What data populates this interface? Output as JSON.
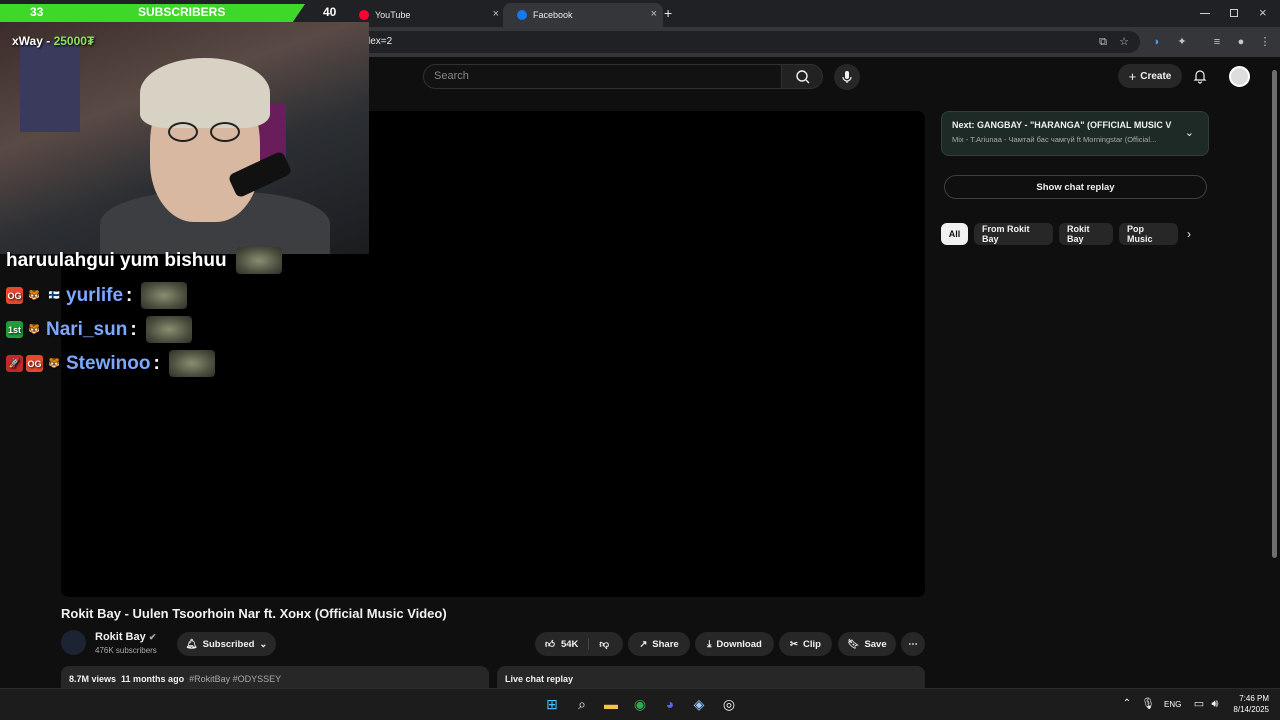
{
  "browser": {
    "tabs": [
      {
        "label": "YouTube",
        "favicon_color": "#ff0033"
      },
      {
        "label": "Facebook",
        "favicon_color": "#1877f2"
      }
    ],
    "url_fragment": "lex=2",
    "close_glyph": "×",
    "new_tab_glyph": "+"
  },
  "youtube": {
    "search_placeholder": "Search",
    "create_label": "Create",
    "video_title": "Rokit Bay - Uulen Tsoorhoin Nar ft. Хонх (Official Music Video)",
    "channel_name": "Rokit Bay",
    "channel_subs": "476K subscribers",
    "subscribed_label": "Subscribed",
    "likes": "54K",
    "share_label": "Share",
    "download_label": "Download",
    "clip_label": "Clip",
    "save_label": "Save",
    "views": "8.7M views",
    "age": "11 months ago",
    "hashtags": "#RokitBay #ODYSSEY",
    "live_chat_label": "Live chat replay",
    "next_title": "Next: GANGBAY - \"HARANGA\" (OFFICIAL MUSIC VI...",
    "next_subtitle": "Mix - T.Ariunaa - Чамтай бас чамгүй ft Morningstar (Official...",
    "show_chat_replay": "Show chat replay",
    "chips": [
      "All",
      "From Rokit Bay",
      "Rokit Bay",
      "Pop Music"
    ]
  },
  "overlay": {
    "sub_goal_current": "33",
    "sub_goal_label": "SUBSCRIBERS",
    "sub_goal_target": "40",
    "sub_goal_progress": 0.825,
    "donation_name": "xWay - ",
    "donation_amount": "25000₮",
    "chat_message": "haruulahgui yum bishuu",
    "chat_lines": [
      {
        "user": "yurlife",
        "badges": [
          "OG",
          "🐯",
          "🇫🇮"
        ]
      },
      {
        "user": "Nari_sun",
        "badges": [
          "1st",
          "🐯"
        ]
      },
      {
        "user": "Stewinoo",
        "badges": [
          "🚀",
          "OG",
          "🐯"
        ]
      }
    ]
  },
  "taskbar": {
    "language": "ENG",
    "time": "7:46 PM",
    "date": "8/14/2025"
  },
  "colors": {
    "accent_green": "#3ed82b",
    "yt_bg": "#0f0f0f",
    "chip_bg": "#272727"
  }
}
